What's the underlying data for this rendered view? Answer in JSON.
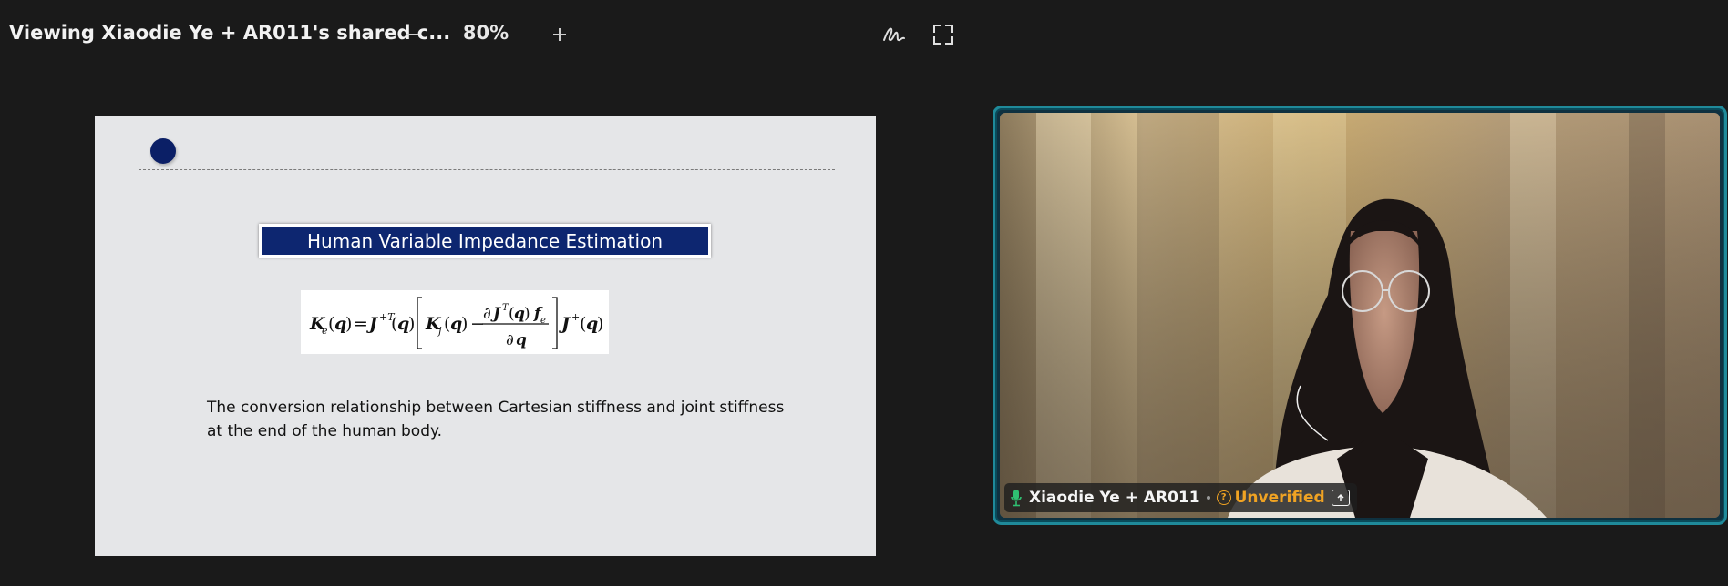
{
  "header": {
    "title": "Viewing Xiaodie Ye + AR011's shared c...",
    "zoom_level": "80%"
  },
  "icons": {
    "zoom_out": "minus-icon",
    "zoom_in": "plus-icon",
    "annotate": "pen-scribble-icon",
    "fullscreen": "fullscreen-icon",
    "mic": "microphone-icon",
    "unverified": "question-icon",
    "share": "upload-icon"
  },
  "slide": {
    "title": "Human Variable Impedance Estimation",
    "caption": "The conversion relationship between Cartesian stiffness and joint stiffness at the end of the human body."
  },
  "participant": {
    "name": "Xiaodie Ye + AR011",
    "status": "Unverified"
  },
  "colors": {
    "background": "#1a1a1a",
    "slide_bg": "#e5e6e8",
    "slide_title_bg": "#0d2670",
    "active_speaker_border": "#1f8a9a",
    "unverified": "#f0a323",
    "mic_active": "#2fbf71"
  }
}
